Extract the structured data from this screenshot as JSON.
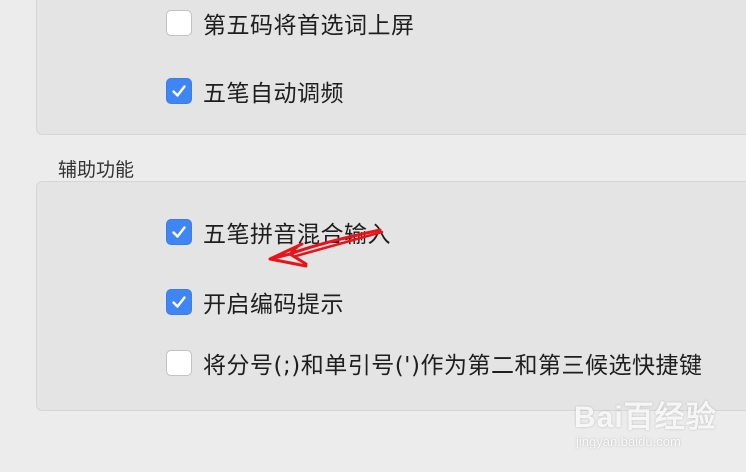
{
  "input_options": {
    "items": [
      {
        "label": "第五码将首选词上屏",
        "checked": false
      },
      {
        "label": "五笔自动调频",
        "checked": true
      }
    ]
  },
  "assist": {
    "title": "辅助功能",
    "items": [
      {
        "label": "五笔拼音混合输入",
        "checked": true
      },
      {
        "label": "开启编码提示",
        "checked": true
      },
      {
        "label": "将分号(;)和单引号(')作为第二和第三候选快捷键",
        "checked": false
      }
    ]
  },
  "annotation": {
    "arrow_color": "#e8141c"
  },
  "watermark": {
    "logo_text": "Bai百经验",
    "url_text": "jingyan.baidu.com"
  },
  "colors": {
    "checkbox_checked": "#3f86f4",
    "background": "#ececec",
    "group_background": "#e4e4e4"
  }
}
